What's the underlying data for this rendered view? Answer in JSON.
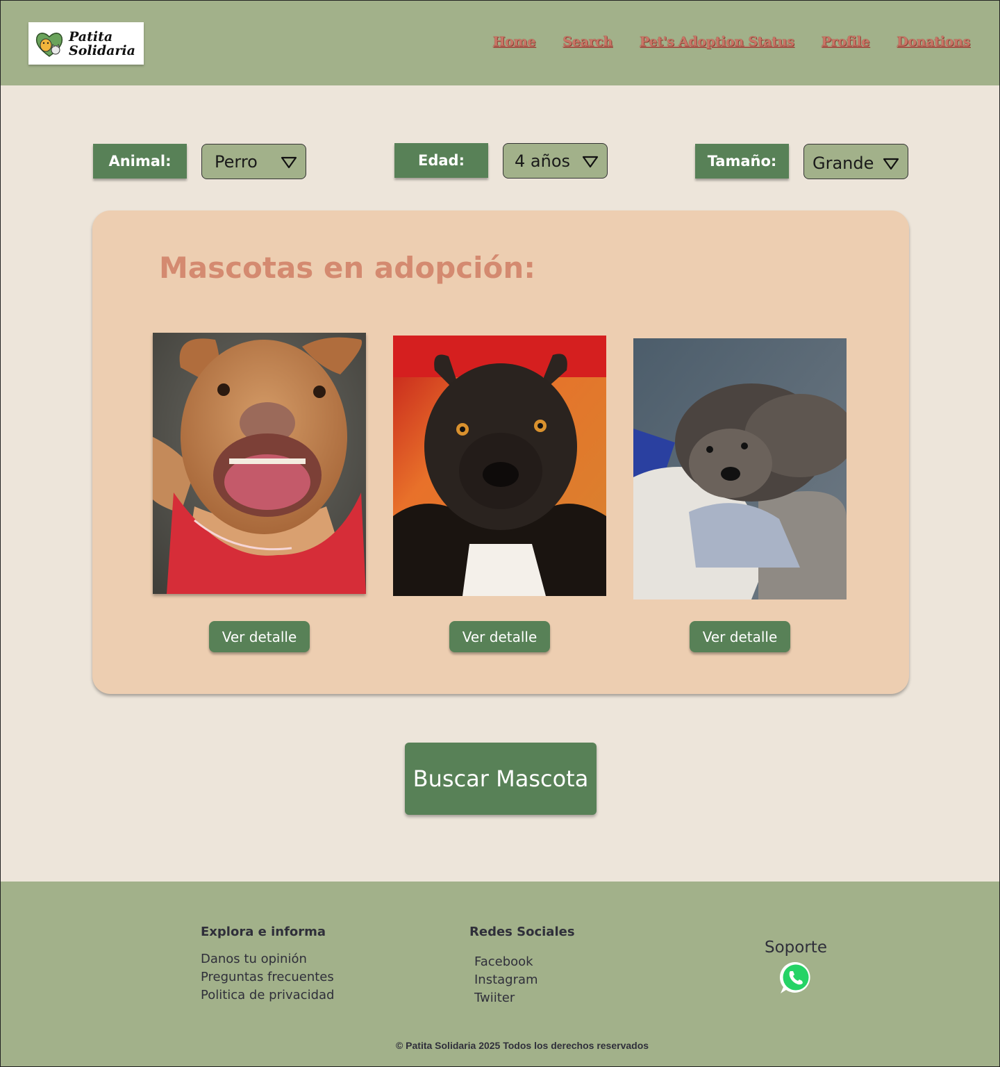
{
  "brand": {
    "line1": "Patita",
    "line2": "Solidaria"
  },
  "nav": [
    "Home",
    "Search",
    "Pet's Adoption Status",
    "Profile",
    "Donations"
  ],
  "filters": {
    "animal": {
      "label": "Animal:",
      "value": "Perro"
    },
    "edad": {
      "label": "Edad:",
      "value": "4 años"
    },
    "tamano": {
      "label": "Tamaño:",
      "value": "Grande"
    }
  },
  "adoption": {
    "title": "Mascotas en adopción:",
    "detail_label": "Ver detalle"
  },
  "search_button": "Buscar Mascota",
  "footer": {
    "explore": {
      "title": "Explora e informa",
      "links": [
        "Danos tu opinión",
        "Preguntas frecuentes",
        "Politica de privacidad"
      ]
    },
    "social": {
      "title": "Redes Sociales",
      "links": [
        "Facebook",
        "Instagram",
        "Twiiter"
      ]
    },
    "support": {
      "title": "Soporte"
    },
    "copyright": "© Patita Solidaria 2025 Todos los derechos reservados"
  },
  "colors": {
    "header": "#a2b18a",
    "accent_green": "#588157",
    "card": "#edceb1",
    "title": "#d48a70",
    "nav_link": "#c97566"
  }
}
